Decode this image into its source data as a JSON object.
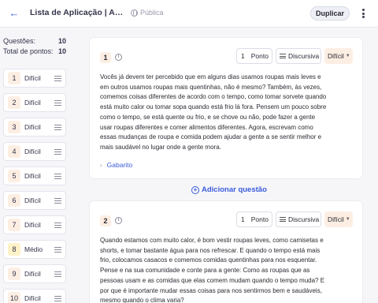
{
  "header": {
    "title": "Lista de Aplicação | Ambien...",
    "visibility": "Pública",
    "duplicate_label": "Duplicar"
  },
  "sidebar": {
    "stats": [
      {
        "label": "Questões:",
        "value": "10"
      },
      {
        "label": "Total de pontos:",
        "value": "10"
      }
    ],
    "items": [
      {
        "num": "1",
        "difficulty": "Difícil"
      },
      {
        "num": "2",
        "difficulty": "Difícil"
      },
      {
        "num": "3",
        "difficulty": "Difícil"
      },
      {
        "num": "4",
        "difficulty": "Difícil"
      },
      {
        "num": "5",
        "difficulty": "Difícil"
      },
      {
        "num": "6",
        "difficulty": "Difícil"
      },
      {
        "num": "7",
        "difficulty": "Difícil"
      },
      {
        "num": "8",
        "difficulty": "Médio"
      },
      {
        "num": "9",
        "difficulty": "Difícil"
      },
      {
        "num": "10",
        "difficulty": "Difícil"
      }
    ]
  },
  "questions": [
    {
      "num": "1",
      "points": "1",
      "points_label": "Ponto",
      "type": "Discursiva",
      "difficulty": "Difícil",
      "text": "Vocês já devem ter percebido que em alguns dias usamos roupas mais leves e em outros usamos roupas mais quentinhas, não é mesmo? Também, às vezes, comemos coisas diferentes de acordo com o tempo, como tomar sorvete quando está muito calor ou tomar sopa quando está frio lá fora. Pensem um pouco sobre como o tempo, se está quente ou frio, e se chove ou não, pode fazer a gente usar roupas diferentes e comer alimentos diferentes. Agora, escrevam como essas mudanças de roupa e comida podem ajudar a gente a se sentir melhor e mais saudável no lugar onde a gente mora.",
      "answer_label": "Gabarito"
    },
    {
      "num": "2",
      "points": "1",
      "points_label": "Ponto",
      "type": "Discursiva",
      "difficulty": "Difícil",
      "text": "Quando estamos com muito calor, é bom vestir roupas leves, como camisetas e shorts, e tomar bastante água para nos refrescar. E quando o tempo está mais frio, colocamos casacos e comemos comidas quentinhas para nos esquentar. Pense e na sua comunidade e conte para a gente: Como as roupas que as pessoas usam e as comidas que elas comem mudam quando o tempo muda? E por que é importante mudar essas coisas para nos sentirmos bem e saudáveis, mesmo quando o clima varia?"
    }
  ],
  "add_question_label": "Adicionar questão",
  "colors": {
    "accent": "#3b5bdb",
    "hard_badge": "#fdeee3",
    "medium_badge": "#fff2c8"
  }
}
